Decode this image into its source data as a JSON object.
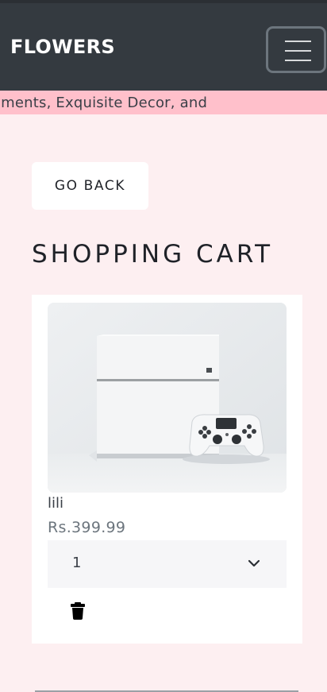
{
  "navbar": {
    "brand": "FLOWERS",
    "toggler_icon": "hamburger-menu-icon"
  },
  "ticker": {
    "text": "Arrangements, Exquisite Decor, and"
  },
  "actions": {
    "go_back_label": "GO BACK"
  },
  "page": {
    "title": "SHOPPING CART"
  },
  "cart": {
    "items": [
      {
        "image_icon": "product-photo-white-console-and-controller",
        "name": "lili",
        "price": "Rs.399.99",
        "quantity": "1",
        "delete_icon": "trash-icon"
      }
    ]
  },
  "colors": {
    "navbar_bg": "#343a40",
    "ticker_bg": "#ffc0cb",
    "page_bg": "#fdeff1",
    "card_bg": "#ffffff",
    "select_bg": "#f6f6f8"
  }
}
